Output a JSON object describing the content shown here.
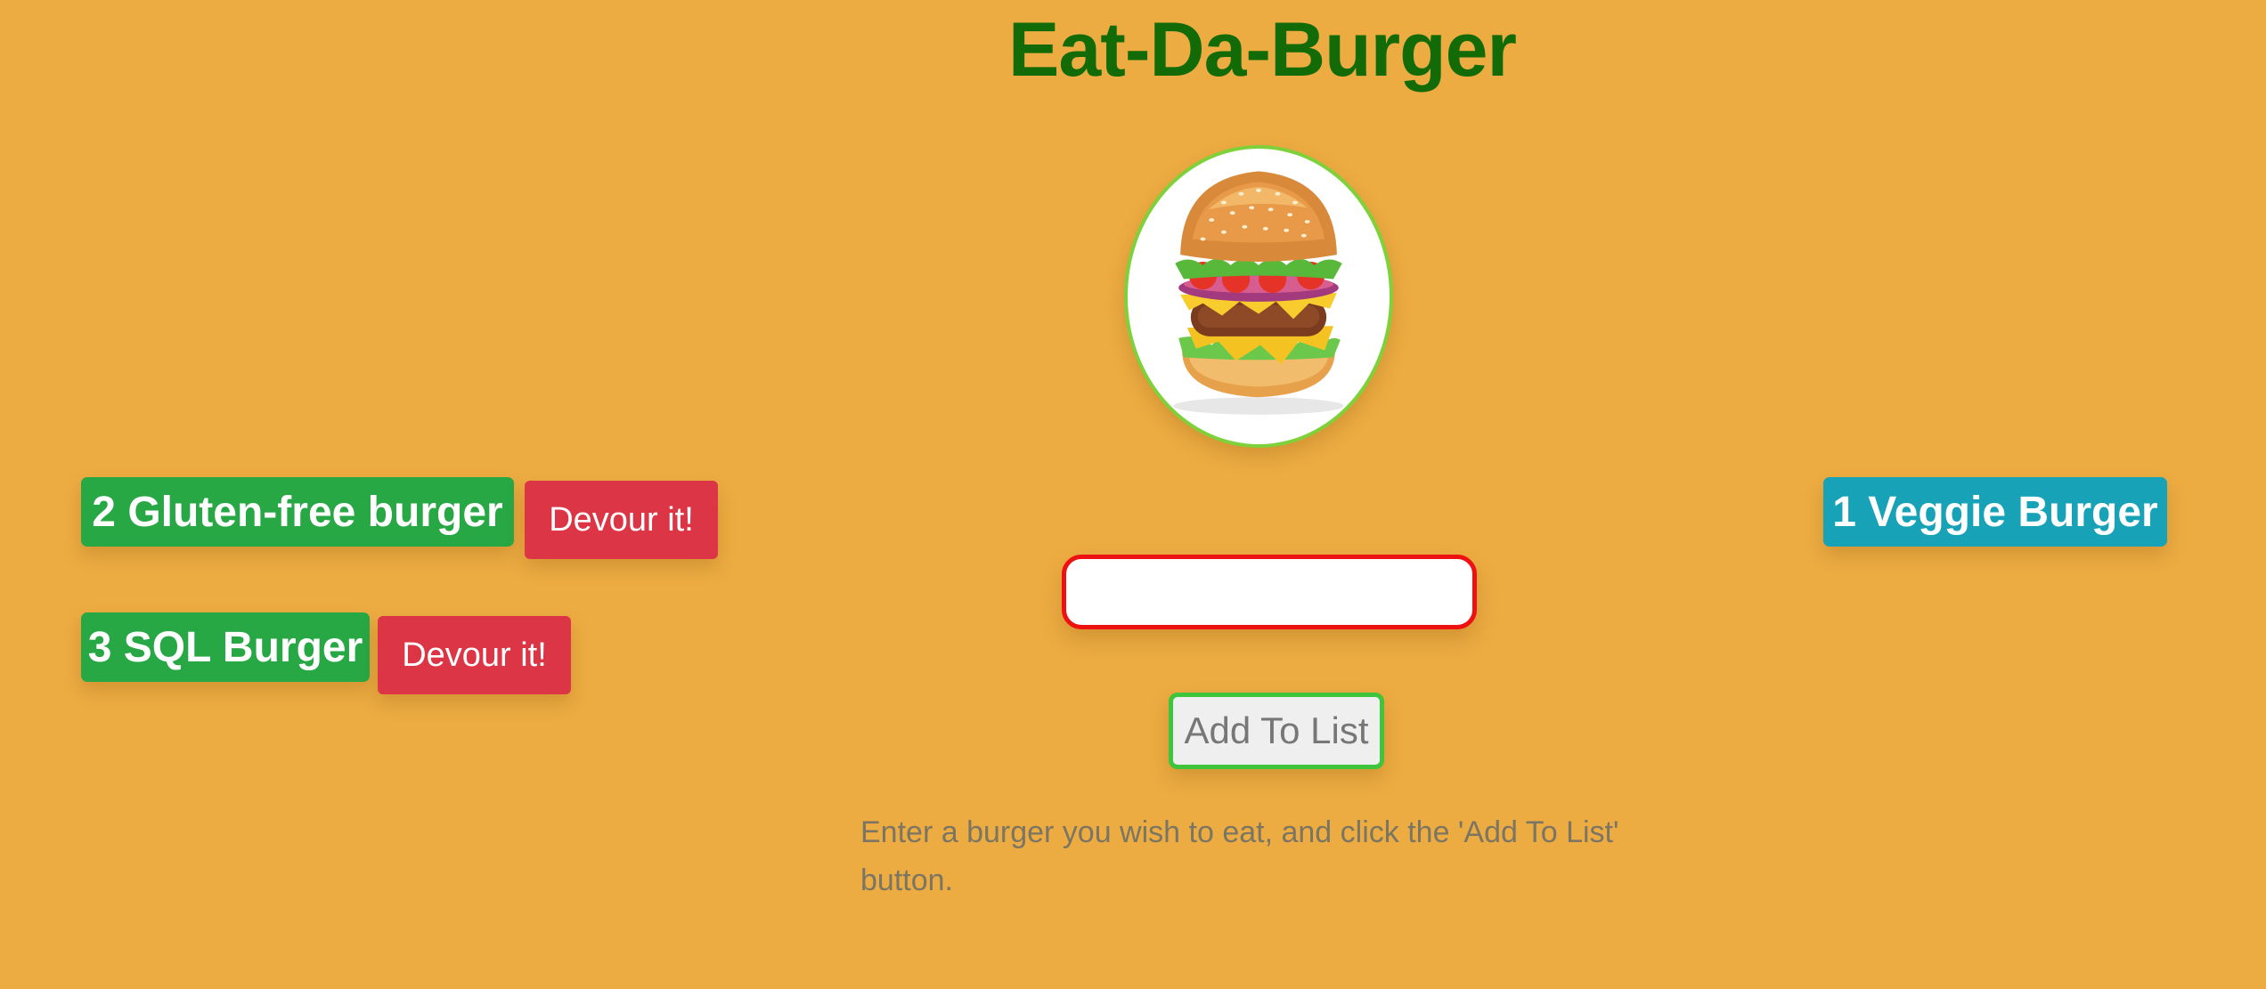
{
  "header": {
    "title": "Eat-Da-Burger"
  },
  "hero_image": {
    "icon": "burger-icon"
  },
  "to_eat": {
    "items": [
      {
        "label": "2 Gluten-free burger",
        "button_label": "Devour it!"
      },
      {
        "label": "3 SQL Burger",
        "button_label": "Devour it!"
      }
    ]
  },
  "devoured": {
    "items": [
      {
        "label": "1 Veggie Burger"
      }
    ]
  },
  "form": {
    "input_value": "",
    "input_placeholder": "",
    "submit_label": "Add To List",
    "instructions": "Enter a burger you wish to eat, and click the 'Add To List' button."
  },
  "colors": {
    "background": "#edac42",
    "title": "#126b06",
    "to_eat_badge": "#28a745",
    "devour_button": "#dc3545",
    "devoured_badge": "#17a2b8",
    "input_border": "#ee1111",
    "submit_border": "#3ec53b",
    "image_border": "#7fd13b"
  }
}
